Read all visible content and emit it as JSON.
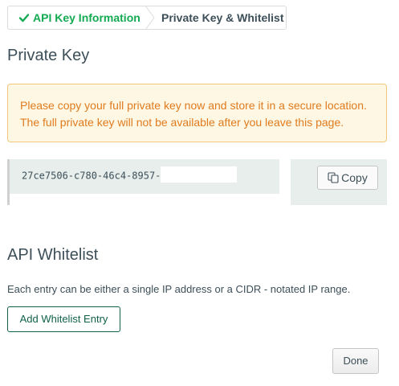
{
  "steps": {
    "step1_label": "API Key Information",
    "step2_label": "Private Key & Whitelist"
  },
  "private_key": {
    "heading": "Private Key",
    "warning_line1": "Please copy your full private key now and store it in a secure location.",
    "warning_line2": "The full private key will not be available after you leave this page.",
    "key_visible": "27ce7506-c780-46c4-8957-",
    "copy_label": "Copy"
  },
  "whitelist": {
    "heading": "API Whitelist",
    "description": "Each entry can be either a single IP address or a CIDR - notated IP range.",
    "add_label": "Add Whitelist Entry"
  },
  "footer": {
    "done_label": "Done"
  },
  "colors": {
    "brand_green": "#13aa52",
    "dark_green": "#116149",
    "warning_text": "#e07b1f",
    "warning_bg": "#fef7e3",
    "warning_border": "#f1c77a"
  }
}
